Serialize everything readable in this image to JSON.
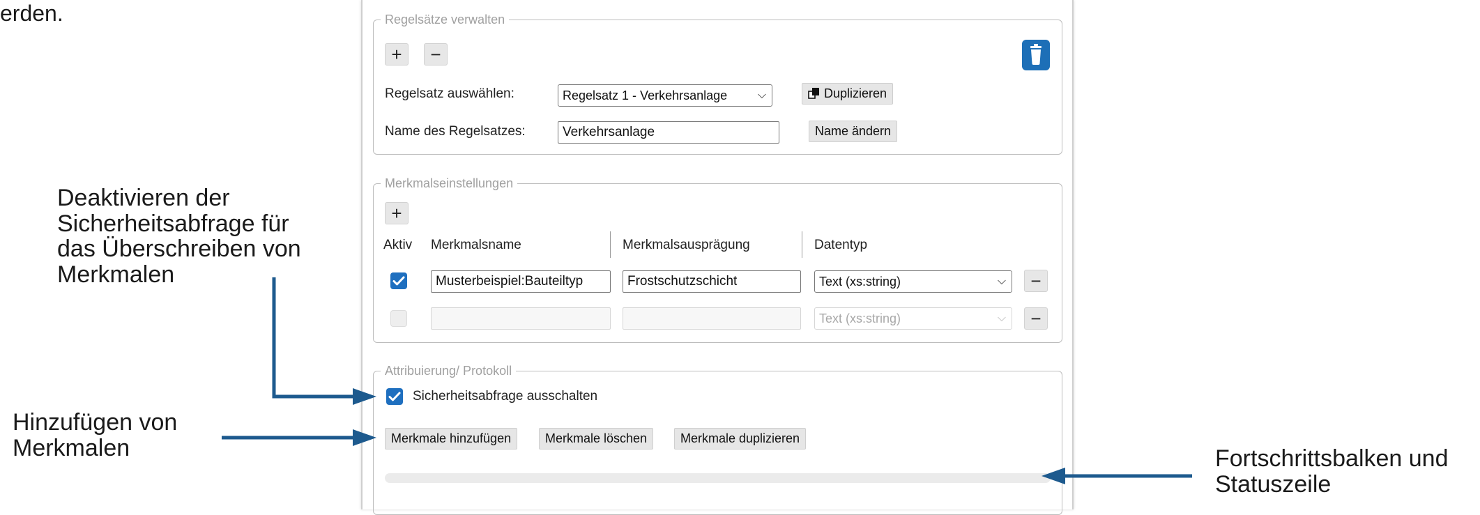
{
  "annotations": {
    "top_fragment": "erden.",
    "deactivate": [
      "Deaktivieren der",
      "Sicherheitsabfrage für",
      "das Überschreiben von",
      "Merkmalen"
    ],
    "add": [
      "Hinzufügen von",
      "Merkmalen"
    ],
    "progress": [
      "Fortschrittsbalken und",
      "Statuszeile"
    ]
  },
  "rulesets": {
    "legend": "Regelsätze verwalten",
    "add_label": "+",
    "remove_label": "−",
    "select_label": "Regelsatz auswählen:",
    "select_value": "Regelsatz 1 - Verkehrsanlage",
    "duplicate_label": "Duplizieren",
    "name_label": "Name des Regelsatzes:",
    "name_value": "Verkehrsanlage",
    "rename_label": "Name ändern"
  },
  "features": {
    "legend": "Merkmalseinstellungen",
    "add_label": "+",
    "headers": {
      "active": "Aktiv",
      "name": "Merkmalsname",
      "value": "Merkmalsausprägung",
      "type": "Datentyp"
    },
    "rows": [
      {
        "active": true,
        "name": "Musterbeispiel:Bauteiltyp",
        "value": "Frostschutzschicht",
        "type": "Text (xs:string)",
        "remove": "−",
        "enabled": true
      },
      {
        "active": false,
        "name": "",
        "value": "",
        "type": "Text (xs:string)",
        "remove": "−",
        "enabled": false
      }
    ]
  },
  "attribution": {
    "legend": "Attribuierung/ Protokoll",
    "safety_checked": true,
    "safety_label": "Sicherheitsabfrage ausschalten",
    "add_button": "Merkmale hinzufügen",
    "delete_button": "Merkmale löschen",
    "duplicate_button": "Merkmale duplizieren",
    "progress": 0
  },
  "colors": {
    "accent": "#1e6fbf",
    "arrow": "#1d5a8e"
  },
  "icons": {
    "trash": "trash-icon",
    "copy": "copy-icon",
    "check": "checkmark-icon",
    "chevron": "chevron-down-icon"
  }
}
